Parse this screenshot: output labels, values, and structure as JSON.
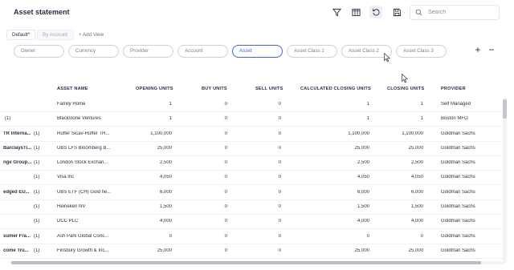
{
  "header": {
    "title": "Asset statement",
    "search_placeholder": "Search"
  },
  "toolbar_icons": [
    "filter-icon",
    "columns-icon",
    "refresh-icon",
    "save-icon",
    "search-icon"
  ],
  "views": {
    "tabs": [
      {
        "label": "Default*",
        "active": true
      },
      {
        "label": "By Account",
        "active": false
      }
    ],
    "add_label": "+ Add View"
  },
  "grouping_chips": [
    {
      "label": "Owner",
      "selected": false
    },
    {
      "label": "Currency",
      "selected": false
    },
    {
      "label": "Provider",
      "selected": false
    },
    {
      "label": "Account",
      "selected": false
    },
    {
      "label": "Asset",
      "selected": true
    },
    {
      "label": "Asset Class 1",
      "selected": false
    },
    {
      "label": "Asset Class 2",
      "selected": false
    },
    {
      "label": "Asset Class 3",
      "selected": false
    }
  ],
  "chip_actions": {
    "add": "+",
    "remove": "−"
  },
  "table": {
    "columns": [
      "ASSET NAME",
      "OPENING UNITS",
      "BUY UNITS",
      "SELL UNITS",
      "CALCULATED CLOSING UNITS",
      "CLOSING UNITS",
      "PROVIDER"
    ],
    "rows": [
      {
        "group": "",
        "count": "",
        "asset": "Family Home",
        "opening": "1",
        "buy": "0",
        "sell": "0",
        "calc": "1",
        "closing": "1",
        "provider": "Self Managed"
      },
      {
        "group": "",
        "count": "(1)",
        "asset": "Blackstone Ventures",
        "opening": "1",
        "buy": "0",
        "sell": "0",
        "calc": "1",
        "closing": "1",
        "provider": "Boston MFO"
      },
      {
        "group": "TR Interna...",
        "count": "(1)",
        "asset": "Ruffer Sicav-Ruffer TR...",
        "opening": "1,100,000",
        "buy": "0",
        "sell": "0",
        "calc": "1,100,000",
        "closing": "1,100,000",
        "provider": "Goldman Sachs"
      },
      {
        "group": "BarclaysTi...",
        "count": "(1)",
        "asset": "UBS LFS Bloomberg B...",
        "opening": "25,000",
        "buy": "0",
        "sell": "0",
        "calc": "25,000",
        "closing": "25,000",
        "provider": "Goldman Sachs"
      },
      {
        "group": "nge Group...",
        "count": "(1)",
        "asset": "London Stock Exchan...",
        "opening": "2,500",
        "buy": "0",
        "sell": "0",
        "calc": "2,500",
        "closing": "2,500",
        "provider": "Goldman Sachs"
      },
      {
        "group": "",
        "count": "(1)",
        "asset": "Visa Inc",
        "opening": "4,050",
        "buy": "0",
        "sell": "0",
        "calc": "4,050",
        "closing": "4,050",
        "provider": "Goldman Sachs"
      },
      {
        "group": "edged EU...",
        "count": "(1)",
        "asset": "UBS ETF (CH) Gold he...",
        "opening": "6,000",
        "buy": "0",
        "sell": "0",
        "calc": "6,000",
        "closing": "6,000",
        "provider": "Goldman Sachs"
      },
      {
        "group": "",
        "count": "(1)",
        "asset": "Heineken NV",
        "opening": "1,500",
        "buy": "0",
        "sell": "0",
        "calc": "1,500",
        "closing": "1,500",
        "provider": "Goldman Sachs"
      },
      {
        "group": "",
        "count": "(1)",
        "asset": "DCC PLC",
        "opening": "4,000",
        "buy": "0",
        "sell": "0",
        "calc": "4,000",
        "closing": "4,000",
        "provider": "Goldman Sachs"
      },
      {
        "group": "sumer Fra...",
        "count": "(1)",
        "asset": "Ash Park Global Cons...",
        "opening": "0",
        "buy": "0",
        "sell": "0",
        "calc": "0",
        "closing": "0",
        "provider": "Goldman Sachs"
      },
      {
        "group": "come Tru...",
        "count": "(1)",
        "asset": "Finsbury Growth & Inc...",
        "opening": "25,000",
        "buy": "0",
        "sell": "0",
        "calc": "25,000",
        "closing": "25,000",
        "provider": "Goldman Sachs"
      }
    ]
  },
  "colors": {
    "accent": "#3e63dd",
    "text": "#2b2f45",
    "muted": "#7c8096",
    "border": "#cfd2dd"
  }
}
